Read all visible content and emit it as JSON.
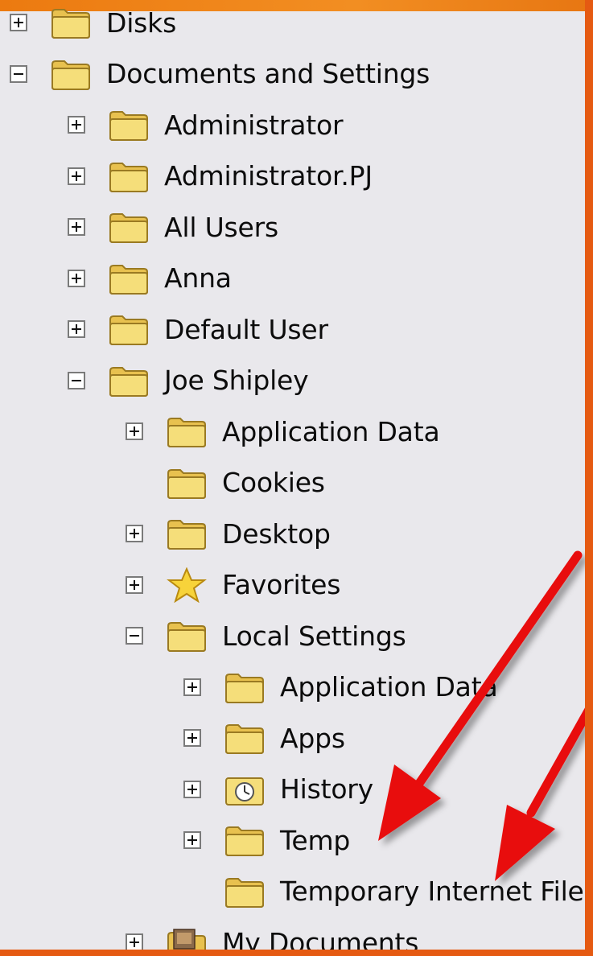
{
  "tree": [
    {
      "label": "Disks",
      "level": 0,
      "expander": "plus",
      "icon": "folder-icon"
    },
    {
      "label": "Documents and Settings",
      "level": 0,
      "expander": "minus",
      "icon": "folder-icon"
    },
    {
      "label": "Administrator",
      "level": 1,
      "expander": "plus",
      "icon": "folder-icon"
    },
    {
      "label": "Administrator.PJ",
      "level": 1,
      "expander": "plus",
      "icon": "folder-icon"
    },
    {
      "label": "All Users",
      "level": 1,
      "expander": "plus",
      "icon": "folder-icon"
    },
    {
      "label": "Anna",
      "level": 1,
      "expander": "plus",
      "icon": "folder-icon"
    },
    {
      "label": "Default User",
      "level": 1,
      "expander": "plus",
      "icon": "folder-icon"
    },
    {
      "label": "Joe Shipley",
      "level": 1,
      "expander": "minus",
      "icon": "folder-icon"
    },
    {
      "label": "Application Data",
      "level": 2,
      "expander": "plus",
      "icon": "folder-icon"
    },
    {
      "label": "Cookies",
      "level": 2,
      "expander": "none",
      "icon": "folder-icon"
    },
    {
      "label": "Desktop",
      "level": 2,
      "expander": "plus",
      "icon": "folder-icon"
    },
    {
      "label": "Favorites",
      "level": 2,
      "expander": "plus",
      "icon": "star-icon"
    },
    {
      "label": "Local Settings",
      "level": 2,
      "expander": "minus",
      "icon": "folder-icon"
    },
    {
      "label": "Application Data",
      "level": 3,
      "expander": "plus",
      "icon": "folder-icon"
    },
    {
      "label": "Apps",
      "level": 3,
      "expander": "plus",
      "icon": "folder-icon"
    },
    {
      "label": "History",
      "level": 3,
      "expander": "plus",
      "icon": "history-icon"
    },
    {
      "label": "Temp",
      "level": 3,
      "expander": "plus",
      "icon": "folder-icon"
    },
    {
      "label": "Temporary Internet Files",
      "level": 3,
      "expander": "none",
      "icon": "folder-icon"
    },
    {
      "label": "My Documents",
      "level": 2,
      "expander": "plus",
      "icon": "my-documents-icon"
    }
  ],
  "colors": {
    "background": "#e9e8ec",
    "folder": "#f5de7a",
    "arrow": "#e8100e",
    "accent": "#ec7a10"
  }
}
